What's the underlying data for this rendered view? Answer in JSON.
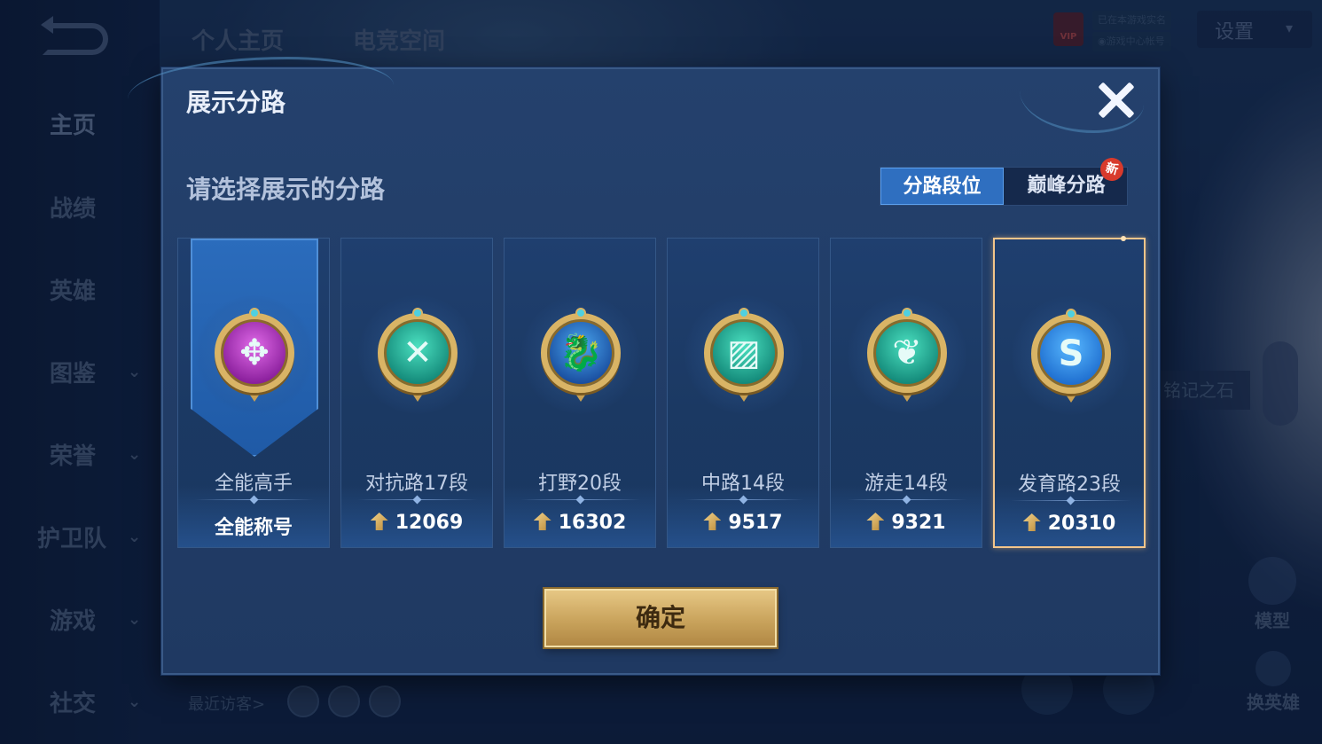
{
  "nav": {
    "items": [
      {
        "label": "主页",
        "has_chevron": false
      },
      {
        "label": "战绩",
        "has_chevron": false
      },
      {
        "label": "英雄",
        "has_chevron": false
      },
      {
        "label": "图鉴",
        "has_chevron": true
      },
      {
        "label": "荣誉",
        "has_chevron": true
      },
      {
        "label": "护卫队",
        "has_chevron": true
      },
      {
        "label": "游戏",
        "has_chevron": true
      },
      {
        "label": "社交",
        "has_chevron": true
      }
    ],
    "chevron": "⌄"
  },
  "top_tabs": [
    "个人主页",
    "电竞空间"
  ],
  "top_right": {
    "settings_label": "设置",
    "settings_chevron": "▾",
    "vip_label": "VIP",
    "status_line1": "已在本游戏实名",
    "status_line2": "◉游戏中心帐号"
  },
  "background": {
    "stone_label": "铭记之石",
    "model_label": "模型",
    "switch_hero_label": "换英雄",
    "visitors_label": "最近访客>"
  },
  "modal": {
    "title": "展示分路",
    "prompt": "请选择展示的分路",
    "toggle": {
      "active_label": "分路段位",
      "inactive_label": "巅峰分路",
      "new_badge": "新"
    },
    "cards": [
      {
        "name": "全能高手",
        "score": "全能称号",
        "glyph": "✥",
        "color": "purple",
        "icon": "all-round-icon",
        "show_score_icon": false,
        "selected": false
      },
      {
        "name": "对抗路17段",
        "score": "12069",
        "glyph": "✕",
        "color": "teal",
        "icon": "clash-lane-icon",
        "show_score_icon": true,
        "selected": false
      },
      {
        "name": "打野20段",
        "score": "16302",
        "glyph": "🐉",
        "color": "blue",
        "icon": "jungle-icon",
        "show_score_icon": true,
        "selected": false
      },
      {
        "name": "中路14段",
        "score": "9517",
        "glyph": "▨",
        "color": "teal",
        "icon": "mid-lane-icon",
        "show_score_icon": true,
        "selected": false
      },
      {
        "name": "游走14段",
        "score": "9321",
        "glyph": "❦",
        "color": "teal",
        "icon": "roam-icon",
        "show_score_icon": true,
        "selected": false
      },
      {
        "name": "发育路23段",
        "score": "20310",
        "glyph": "S",
        "color": "sky",
        "icon": "farm-lane-icon",
        "show_score_icon": true,
        "selected": true
      }
    ],
    "confirm_label": "确定"
  },
  "colors": {
    "accent_blue": "#2f6fc0",
    "gold": "#d9b465",
    "selected_border": "#f3c58a"
  }
}
